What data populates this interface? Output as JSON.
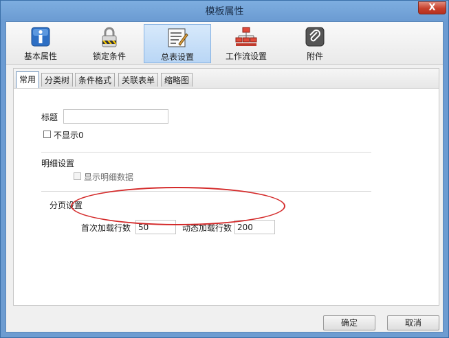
{
  "window": {
    "title": "模板属性",
    "close_label": "X"
  },
  "toolbar": {
    "items": [
      {
        "label": "基本属性",
        "icon": "info-icon"
      },
      {
        "label": "锁定条件",
        "icon": "lock-icon"
      },
      {
        "label": "总表设置",
        "icon": "summary-table-icon"
      },
      {
        "label": "工作流设置",
        "icon": "workflow-icon"
      },
      {
        "label": "附件",
        "icon": "paperclip-icon"
      }
    ],
    "active_index": 2
  },
  "tabs": [
    {
      "label": "常用"
    },
    {
      "label": "分类树"
    },
    {
      "label": "条件格式"
    },
    {
      "label": "关联表单"
    },
    {
      "label": "缩略图"
    }
  ],
  "form": {
    "title_label": "标题",
    "title_value": "",
    "hide_zero_label": "不显示0",
    "detail_section_label": "明细设置",
    "show_detail_label": "显示明细数据",
    "paging_section_label": "分页设置",
    "first_load_rows_label": "首次加载行数",
    "first_load_rows_value": "50",
    "dynamic_load_rows_label": "动态加载行数",
    "dynamic_load_rows_value": "200"
  },
  "buttons": {
    "ok_label": "确定",
    "cancel_label": "取消"
  },
  "colors": {
    "highlight": "#d42a2a",
    "title_bar": "#6b9bd2",
    "close": "#c7402d"
  }
}
